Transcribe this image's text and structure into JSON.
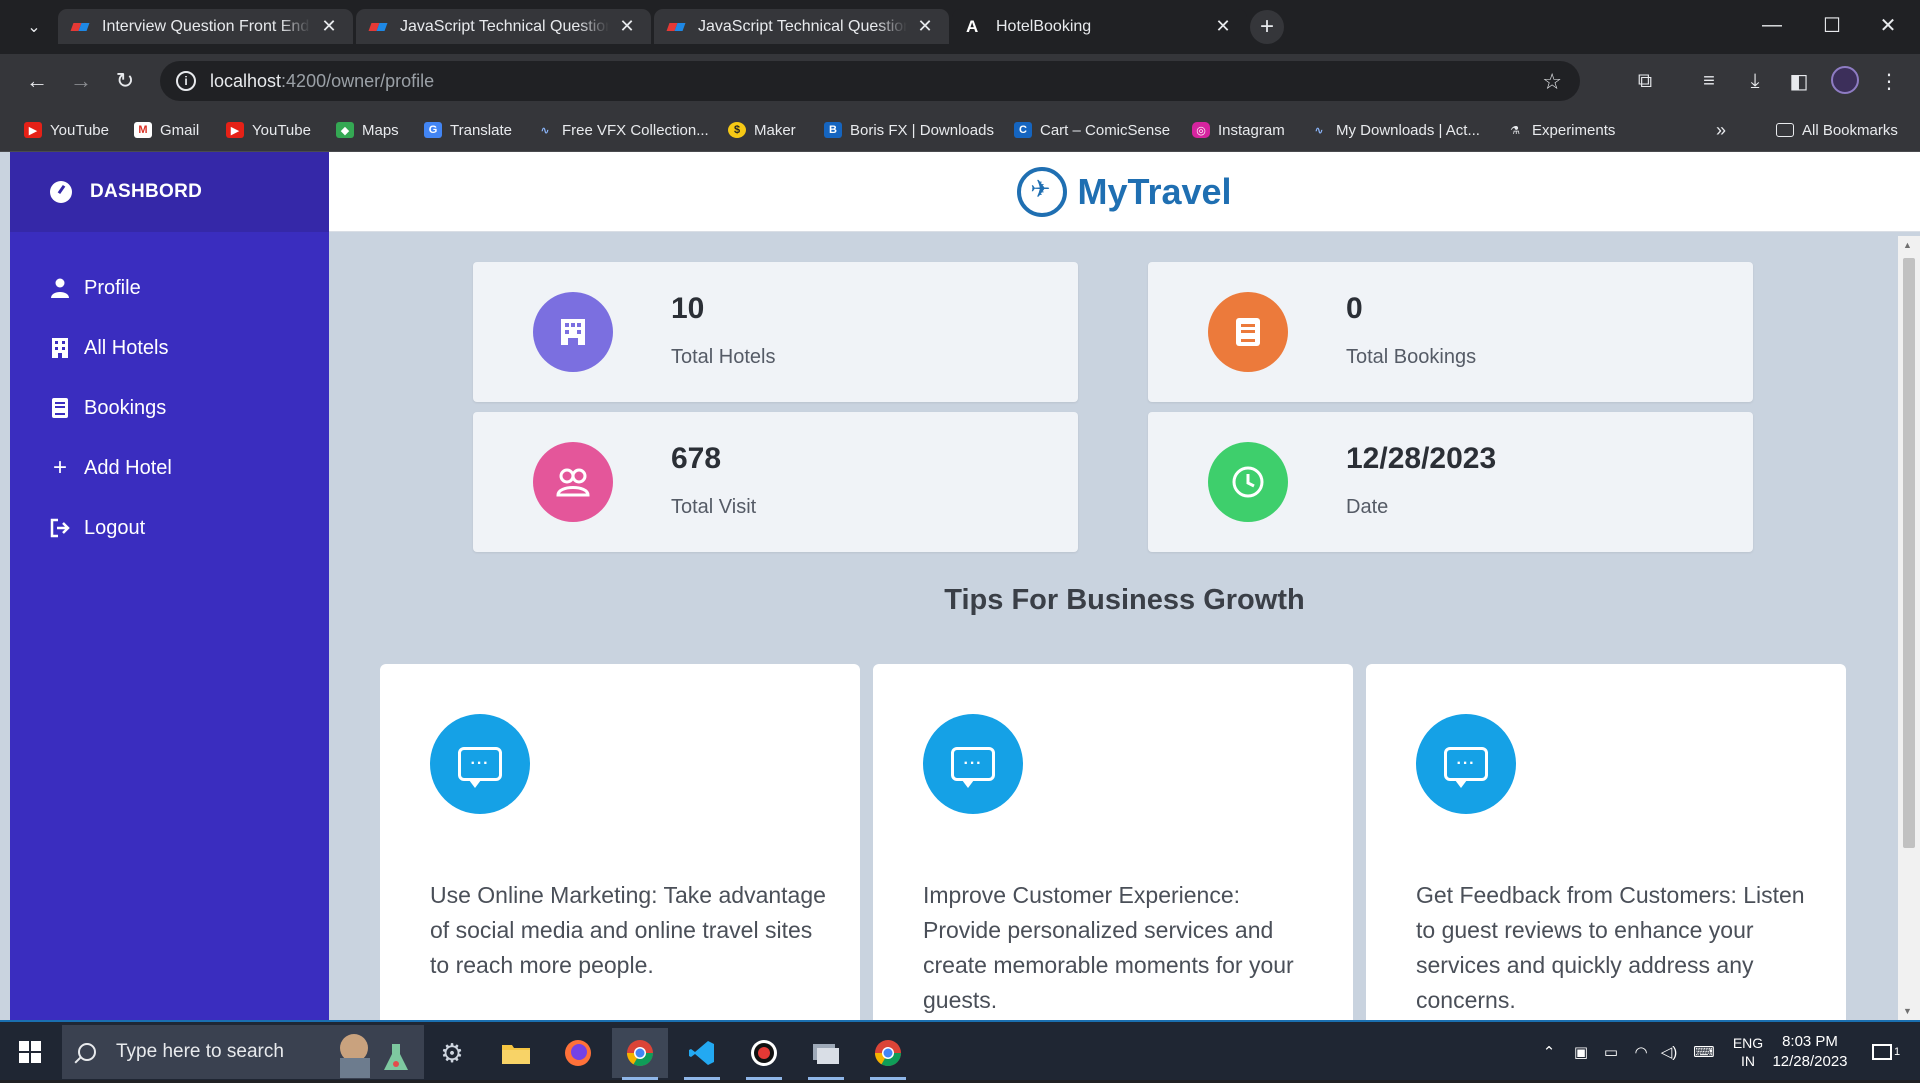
{
  "browser": {
    "tabs": [
      {
        "title": "Interview Question Front End -",
        "active": false
      },
      {
        "title": "JavaScript Technical Questions -",
        "active": false
      },
      {
        "title": "JavaScript Technical Questions -",
        "active": false
      },
      {
        "title": "HotelBooking",
        "active": true
      }
    ],
    "url_host": "localhost",
    "url_path": ":4200/owner/profile",
    "bookmarks": [
      "YouTube",
      "Gmail",
      "YouTube",
      "Maps",
      "Translate",
      "Free VFX Collection...",
      "Maker",
      "Boris FX | Downloads",
      "Cart – ComicSense",
      "Instagram",
      "My Downloads | Act...",
      "Experiments"
    ],
    "all_bookmarks": "All Bookmarks"
  },
  "sidebar": {
    "title": "DASHBORD",
    "items": [
      {
        "label": "Profile",
        "icon": "user-icon"
      },
      {
        "label": "All Hotels",
        "icon": "building-icon"
      },
      {
        "label": "Bookings",
        "icon": "book-icon"
      },
      {
        "label": "Add Hotel",
        "icon": "plus-icon"
      },
      {
        "label": "Logout",
        "icon": "logout-icon"
      }
    ]
  },
  "header": {
    "brand": "MyTravel"
  },
  "stats": [
    {
      "value": "10",
      "label": "Total Hotels",
      "color": "#7b6fe0",
      "icon": "hotel-icon"
    },
    {
      "value": "0",
      "label": "Total Bookings",
      "color": "#ec7a3b",
      "icon": "book-icon"
    },
    {
      "value": "678",
      "label": "Total Visit",
      "color": "#e4569a",
      "icon": "users-icon"
    },
    {
      "value": "12/28/2023",
      "label": "Date",
      "color": "#3ecf6c",
      "icon": "clock-icon"
    }
  ],
  "tips": {
    "title": "Tips For Business Growth",
    "items": [
      {
        "text": "Use Online Marketing: Take advantage of social media and online travel sites to reach more people."
      },
      {
        "text": "Improve Customer Experience: Provide personalized services and create memorable moments for your guests."
      },
      {
        "text": "Get Feedback from Customers: Listen to guest reviews to enhance your services and quickly address any concerns."
      }
    ]
  },
  "taskbar": {
    "search_placeholder": "Type here to search",
    "lang_line1": "ENG",
    "lang_line2": "IN",
    "time": "8:03 PM",
    "date": "12/28/2023",
    "notification_count": "1"
  }
}
